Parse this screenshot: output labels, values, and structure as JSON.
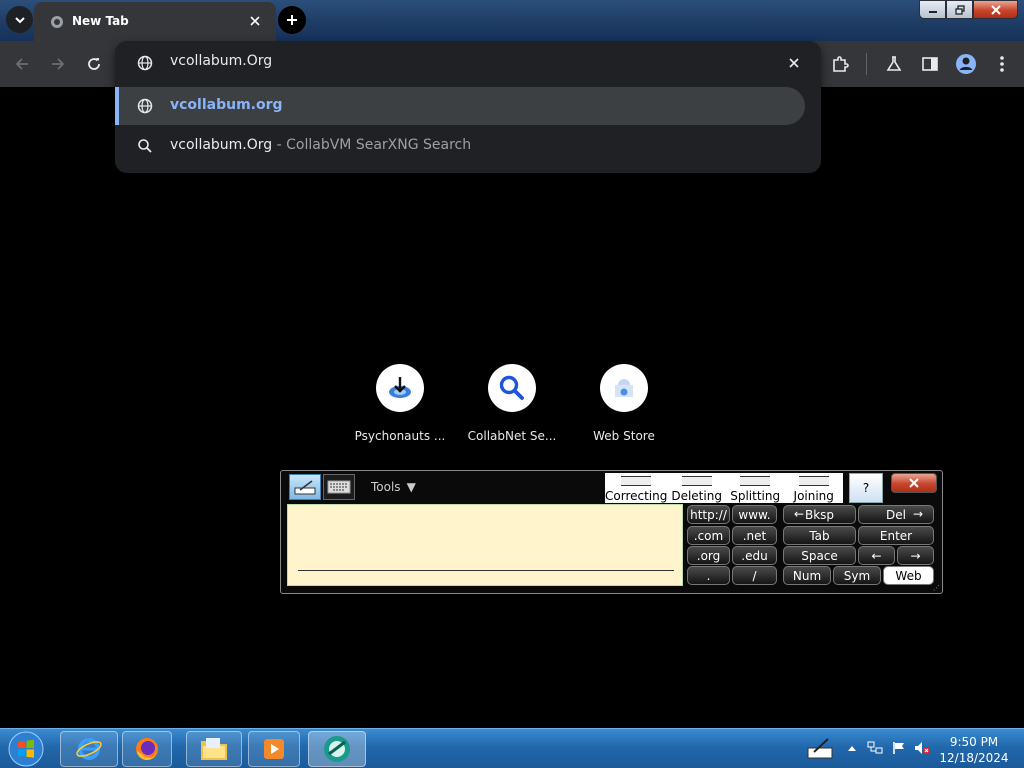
{
  "tab": {
    "title": "New Tab"
  },
  "omnibox": {
    "input_value": "vcollabum.Org",
    "suggestions": [
      {
        "main": "vcollabum.org",
        "sub": "",
        "icon": "globe-icon"
      },
      {
        "main": "vcollabum.Org",
        "sub": " - CollabVM SearXNG Search",
        "icon": "search-icon"
      }
    ]
  },
  "shortcuts": [
    {
      "label": "Psychonauts ..."
    },
    {
      "label": "CollabNet Se..."
    },
    {
      "label": "Web Store"
    }
  ],
  "tablet_panel": {
    "tools_label": "Tools",
    "gestures": [
      "Correcting",
      "Deleting",
      "Splitting",
      "Joining"
    ],
    "help_label": "?",
    "keys": {
      "http": "http://",
      "www": "www.",
      "com": ".com",
      "net": ".net",
      "org": ".org",
      "edu": ".edu",
      "dot": ".",
      "slash": "/",
      "bksp": "Bksp",
      "del": "Del",
      "tab": "Tab",
      "enter": "Enter",
      "space": "Space",
      "num": "Num",
      "sym": "Sym",
      "web": "Web",
      "left_arrow": "←",
      "right_arrow": "→"
    }
  },
  "taskbar": {
    "time": "9:50 PM",
    "date": "12/18/2024"
  },
  "colors": {
    "accent": "#8ab4f8",
    "toolbar": "#35363a",
    "dropdown": "#202124",
    "writing_pad": "#fff4cc",
    "taskbar": "#2268ac"
  }
}
